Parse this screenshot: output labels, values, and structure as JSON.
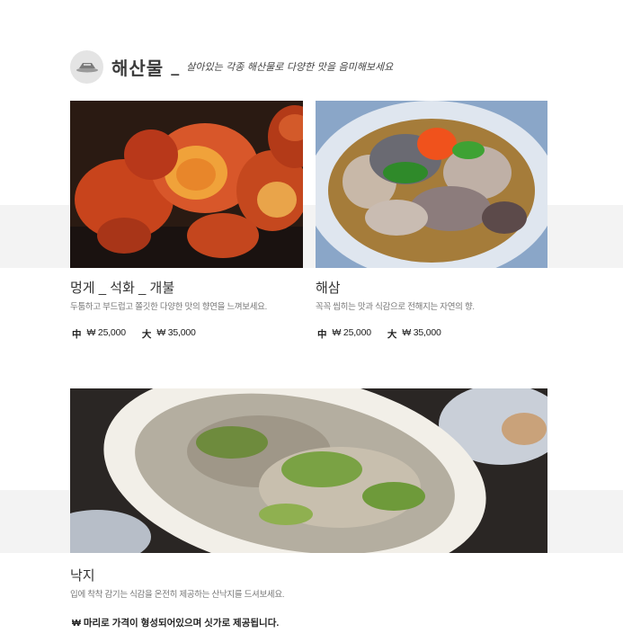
{
  "header": {
    "title": "해산물",
    "separator": "_",
    "subtitle": "살아있는 각종 해산물로 다양한 맛을 음미해보세요"
  },
  "items": [
    {
      "name": "멍게 _ 석화 _ 개불",
      "description": "두툼하고 부드럽고 쫄깃한 다양한 맛의 향연을 느껴보세요.",
      "prices": [
        {
          "size": "中",
          "price": "₩ 25,000"
        },
        {
          "size": "大",
          "price": "₩ 35,000"
        }
      ]
    },
    {
      "name": "해삼",
      "description": "꼭꼭 씹히는 맛과 식감으로 전해지는 자연의 향.",
      "prices": [
        {
          "size": "中",
          "price": "₩ 25,000"
        },
        {
          "size": "大",
          "price": "₩ 35,000"
        }
      ]
    },
    {
      "name": "낙지",
      "description": "입에 착착 감기는 식감을 온전히 제공하는 산낙지를 드셔보세요.",
      "note": "₩ 마리로 가격이 형성되어있으며 싯가로 제공됩니다."
    }
  ],
  "icons": {
    "header_logo": "dish-icon"
  },
  "colors": {
    "band": "#f3f3f3",
    "text": "#333333",
    "muted": "#777777"
  }
}
